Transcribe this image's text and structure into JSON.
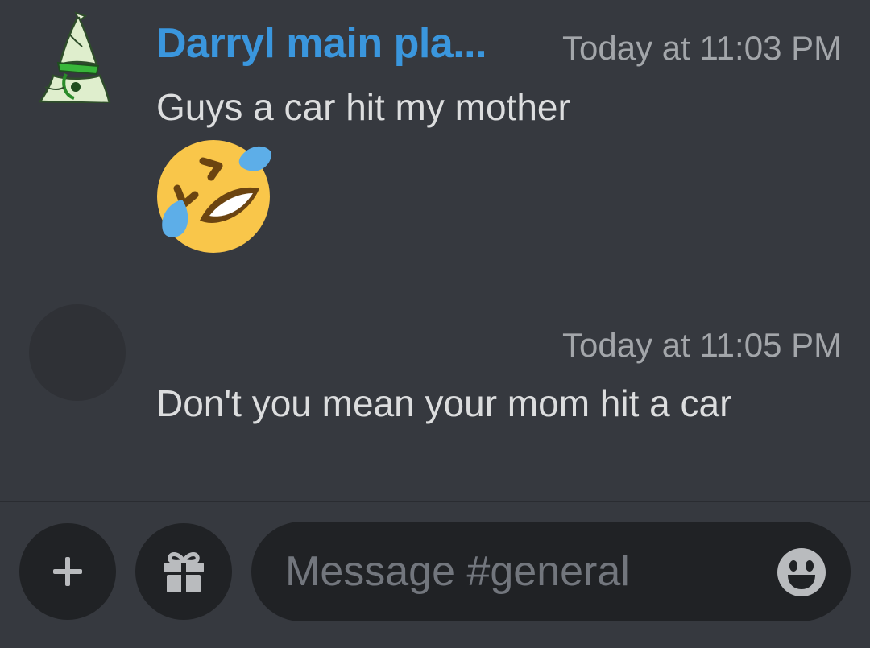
{
  "channel": "general",
  "messages": [
    {
      "author": "Darryl main pla...",
      "author_color": "#3a96dd",
      "timestamp": "Today at 11:03 PM",
      "text": "Guys a car hit my mother",
      "emoji": "rolling-on-floor-laughing"
    },
    {
      "timestamp": "Today at 11:05 PM",
      "text": "Don't you mean your mom hit a car"
    }
  ],
  "composer": {
    "placeholder": "Message #general",
    "plus_icon": "plus-icon",
    "gift_icon": "gift-icon",
    "emoji_icon": "smile-icon"
  },
  "colors": {
    "background": "#36393f",
    "input_background": "#202225",
    "text": "#dcddde",
    "muted": "#a3a6aa",
    "username": "#3a96dd"
  }
}
